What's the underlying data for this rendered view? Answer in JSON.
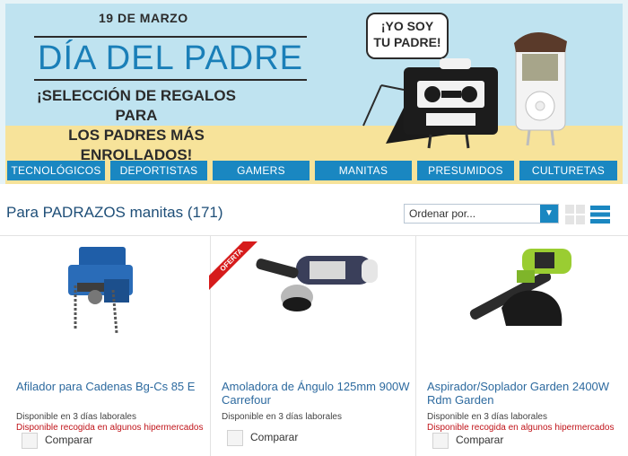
{
  "banner": {
    "date": "19 DE MARZO",
    "title": "DÍA DEL PADRE",
    "subtitle_line1": "¡SELECCIÓN DE REGALOS PARA",
    "subtitle_line2": "LOS PADRES MÁS ENROLLADOS!",
    "speech_line1": "¡YO SOY",
    "speech_line2": "TU PADRE!"
  },
  "nav": {
    "items": [
      "TECNOLÓGICOS",
      "DEPORTISTAS",
      "GAMERS",
      "MANITAS",
      "PRESUMIDOS",
      "CULTURETAS"
    ]
  },
  "listing": {
    "heading": "Para PADRAZOS manitas (171)",
    "sort_placeholder": "Ordenar por..."
  },
  "products": [
    {
      "title_line1": "Afilador para Cadenas Bg-Cs 85 E",
      "title_line2": "",
      "availability": "Disponible en 3 días laborales",
      "pickup": "Disponible recogida en algunos hipermercados",
      "compare": "Comparar"
    },
    {
      "title_line1": "Amoladora de Ángulo 125mm 900W",
      "title_line2": "Carrefour",
      "availability": "Disponible en 3 días laborales",
      "pickup": "",
      "compare": "Comparar",
      "badge": "OFERTA"
    },
    {
      "title_line1": "Aspirador/Soplador Garden 2400W",
      "title_line2": "Rdm Garden",
      "availability": "Disponible en 3 días laborales",
      "pickup": "Disponible recogida en algunos hipermercados",
      "compare": "Comparar"
    }
  ],
  "colors": {
    "accent": "#1a87c1",
    "title_blue": "#1a7fb8",
    "link": "#2d6a9f",
    "alert_red": "#c0141a",
    "sky": "#bfe3f0",
    "sand": "#f7e39a"
  },
  "icons": [
    "sort-dropdown-arrow-icon",
    "grid-view-icon",
    "list-view-icon",
    "compare-checkbox-icon"
  ]
}
